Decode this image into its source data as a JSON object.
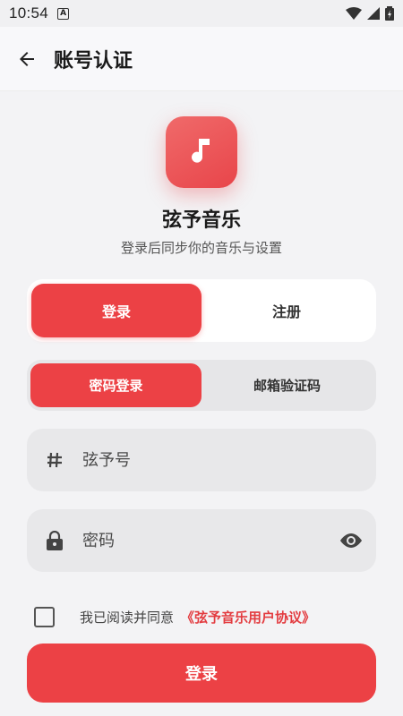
{
  "status_bar": {
    "time": "10:54",
    "notification_badge": "A"
  },
  "app_bar": {
    "title": "账号认证"
  },
  "brand": {
    "app_name": "弦予音乐",
    "subtitle": "登录后同步你的音乐与设置",
    "accent_color": "#ec4145"
  },
  "mode_tabs": {
    "login": "登录",
    "register": "注册",
    "selected": "登录"
  },
  "method_tabs": {
    "password": "密码登录",
    "email_code": "邮箱验证码",
    "selected": "密码登录"
  },
  "fields": {
    "account_placeholder": "弦予号",
    "password_placeholder": "密码"
  },
  "agreement": {
    "text": "我已阅读并同意",
    "link": "《弦予音乐用户协议》",
    "checked": false
  },
  "submit": {
    "label": "登录"
  }
}
